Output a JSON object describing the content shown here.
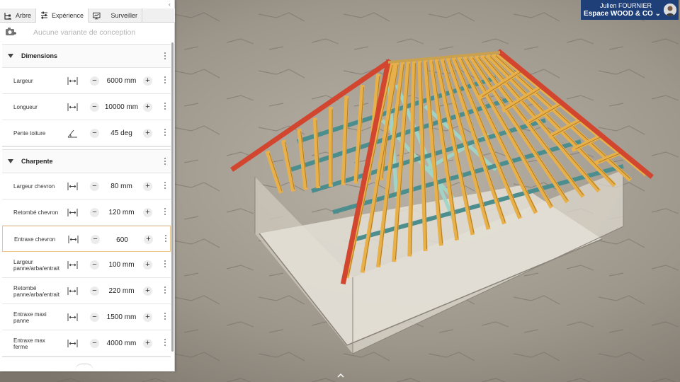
{
  "tabs": [
    {
      "label": "Arbre",
      "icon": "tree-icon",
      "active": false
    },
    {
      "label": "Expérience",
      "icon": "sliders-icon",
      "active": true
    },
    {
      "label": "Surveiller",
      "icon": "monitor-icon",
      "active": false
    }
  ],
  "variant": {
    "placeholder": "Aucune variante de conception",
    "icon": "camera-add-icon"
  },
  "sections": {
    "dimensions": {
      "title": "Dimensions",
      "rows": [
        {
          "label": "Largeur",
          "value": "6000 mm"
        },
        {
          "label": "Longueur",
          "value": "10000 mm"
        },
        {
          "label": "Pente toiture",
          "value": "45 deg"
        }
      ]
    },
    "charpente": {
      "title": "Charpente",
      "rows": [
        {
          "label": "Largeur chevron",
          "value": "80 mm"
        },
        {
          "label": "Retombé chevron",
          "value": "120 mm"
        },
        {
          "label": "Entraxe chevron",
          "value": "600"
        },
        {
          "label": "Largeur panne/arba/entrait",
          "value": "100 mm"
        },
        {
          "label": "Retombé panne/arba/entrait",
          "value": "220 mm"
        },
        {
          "label": "Entraxe maxi panne",
          "value": "1500 mm"
        },
        {
          "label": "Entraxe max ferme",
          "value": "4000 mm"
        }
      ]
    }
  },
  "controls": {
    "minus": "−",
    "plus": "+"
  },
  "user": {
    "name": "Julien FOURNIER",
    "org": "Espace WOOD & CO ⌄"
  },
  "colors": {
    "rafter": "#e8b04a",
    "hip": "#d2452f",
    "purlin": "#4c8e8e",
    "truss": "#9fd6c8",
    "wall": "#d8d2c6",
    "header": "#1f3f78"
  }
}
